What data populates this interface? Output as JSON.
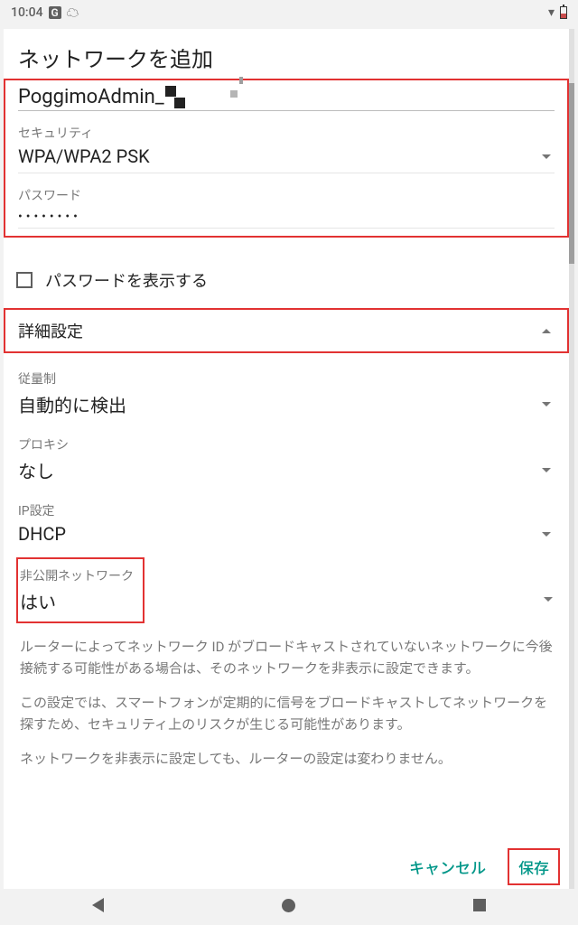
{
  "status": {
    "time": "10:04",
    "g": "G"
  },
  "title": "ネットワークを追加",
  "ssid": {
    "value": "PoggimoAdmin_"
  },
  "security": {
    "label": "セキュリティ",
    "value": "WPA/WPA2 PSK"
  },
  "password": {
    "label": "パスワード",
    "masked": "••••••••"
  },
  "show_password": "パスワードを表示する",
  "advanced": {
    "label": "詳細設定"
  },
  "metered": {
    "label": "従量制",
    "value": "自動的に検出"
  },
  "proxy": {
    "label": "プロキシ",
    "value": "なし"
  },
  "ip": {
    "label": "IP設定",
    "value": "DHCP"
  },
  "hidden": {
    "label": "非公開ネットワーク",
    "value": "はい"
  },
  "help": {
    "p1": "ルーターによってネットワーク ID がブロードキャストされていないネットワークに今後接続する可能性がある場合は、そのネットワークを非表示に設定できます。",
    "p2": "この設定では、スマートフォンが定期的に信号をブロードキャストしてネットワークを探すため、セキュリティ上のリスクが生じる可能性があります。",
    "p3": "ネットワークを非表示に設定しても、ルーターの設定は変わりません。"
  },
  "buttons": {
    "cancel": "キャンセル",
    "save": "保存"
  }
}
